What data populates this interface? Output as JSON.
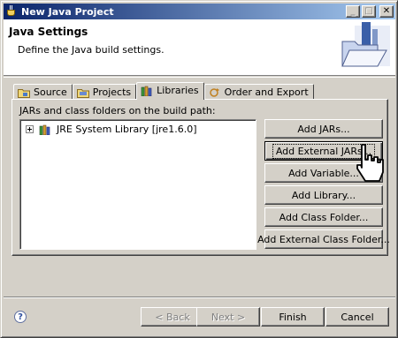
{
  "window": {
    "title": "New Java Project",
    "controls": [
      "minimize",
      "maximize",
      "close"
    ]
  },
  "header": {
    "title": "Java Settings",
    "description": "Define the Java build settings.",
    "banner_icon": "folder-wizard-icon"
  },
  "tabs": [
    {
      "label": "Source",
      "icon": "source-folder-icon",
      "active": false
    },
    {
      "label": "Projects",
      "icon": "projects-icon",
      "active": false
    },
    {
      "label": "Libraries",
      "icon": "libraries-icon",
      "active": true
    },
    {
      "label": "Order and Export",
      "icon": "order-export-icon",
      "active": false
    }
  ],
  "libraries": {
    "label": "JARs and class folders on the build path:",
    "tree": [
      {
        "label": "JRE System Library [jre1.6.0]",
        "expanded": false,
        "icon": "library-icon"
      }
    ],
    "buttons": [
      {
        "label": "Add JARs...",
        "enabled": true
      },
      {
        "label": "Add External JARs...",
        "enabled": true,
        "focused": true
      },
      {
        "label": "Add Variable...",
        "enabled": true
      },
      {
        "label": "Add Library...",
        "enabled": true
      },
      {
        "label": "Add Class Folder...",
        "enabled": true
      },
      {
        "label": "Add External Class Folder...",
        "enabled": true
      }
    ]
  },
  "footer": {
    "help_icon": "help-icon",
    "back_label": "< Back",
    "next_label": "Next >",
    "finish_label": "Finish",
    "cancel_label": "Cancel"
  }
}
